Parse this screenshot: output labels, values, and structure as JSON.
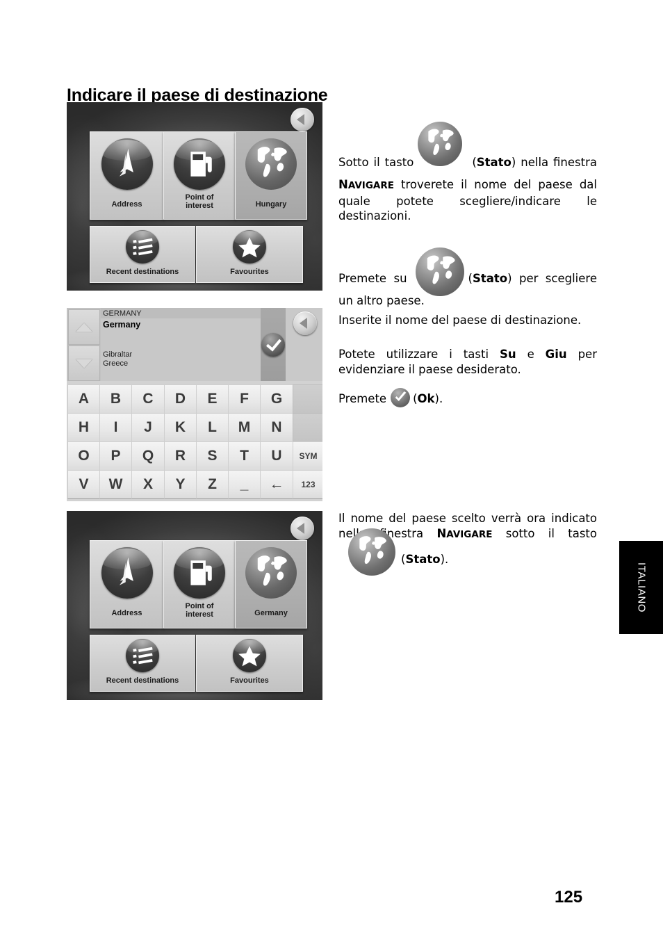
{
  "page": {
    "title": "Indicare il paese di destinazione",
    "number": "125",
    "language_tab": "ITALIANO"
  },
  "screenshots": [
    {
      "name": "navigate-window-hungary",
      "back_button_icon": "back-arrow-icon",
      "tiles": [
        {
          "label": "Address",
          "icon": "address-flag-icon",
          "state": "normal"
        },
        {
          "label": "Point of\ninterest",
          "line1": "Point of",
          "line2": "interest",
          "icon": "fuel-pump-icon",
          "state": "normal"
        },
        {
          "label": "Hungary",
          "icon": "globe-icon",
          "state": "dimmed"
        },
        {
          "label": "Recent destinations",
          "icon": "list-icon",
          "state": "normal"
        },
        {
          "label": "Favourites",
          "icon": "star-icon",
          "state": "normal"
        }
      ]
    },
    {
      "name": "country-keyboard-window",
      "list_header": "GERMANY",
      "selected_item": "Germany",
      "list_items": [
        "Gibraltar",
        "Greece"
      ],
      "up_button_icon": "triangle-up-icon",
      "down_button_icon": "triangle-down-icon",
      "ok_button_icon": "check-icon",
      "back_button_icon": "back-arrow-icon",
      "keyboard_rows": [
        [
          "A",
          "B",
          "C",
          "D",
          "E",
          "F",
          "G",
          ""
        ],
        [
          "H",
          "I",
          "J",
          "K",
          "L",
          "M",
          "N",
          ""
        ],
        [
          "O",
          "P",
          "Q",
          "R",
          "S",
          "T",
          "U",
          "SYM"
        ],
        [
          "V",
          "W",
          "X",
          "Y",
          "Z",
          "_",
          "←",
          "123"
        ]
      ]
    },
    {
      "name": "navigate-window-germany",
      "back_button_icon": "back-arrow-icon",
      "tiles": [
        {
          "label": "Address",
          "icon": "address-flag-icon",
          "state": "normal"
        },
        {
          "label": "Point of\ninterest",
          "line1": "Point of",
          "line2": "interest",
          "icon": "fuel-pump-icon",
          "state": "normal"
        },
        {
          "label": "Germany",
          "icon": "globe-icon",
          "state": "dimmed"
        },
        {
          "label": "Recent destinations",
          "icon": "list-icon",
          "state": "normal"
        },
        {
          "label": "Favourites",
          "icon": "star-icon",
          "state": "normal"
        }
      ]
    }
  ],
  "body": {
    "p1": {
      "before_icon": "Sotto il tasto",
      "icon": "globe-icon",
      "after_icon_1": "(",
      "bold_stato": "Stato",
      "after_icon_2": ") nella finestra ",
      "smallcaps_navigare_big": "N",
      "smallcaps_navigare_rest": "AVIGARE",
      "tail": " troverete il nome del paese dal quale potete scegliere/indicare le destinazioni."
    },
    "p2": {
      "before_icon": "Premete su",
      "icon": "globe-icon",
      "open_paren": "(",
      "bold_stato": "Stato",
      "tail": ") per scegliere un altro paese."
    },
    "p3": {
      "text": "Inserite il nome del paese di destinazione."
    },
    "p4": {
      "part1": "Potete utilizzare i tasti ",
      "bold_su": "Su",
      "part2": " e ",
      "bold_giu": "Giu",
      "part3": " per evidenziare il paese desiderato."
    },
    "p5": {
      "before_icon": "Premete",
      "icon": "check-icon",
      "open_paren": "(",
      "bold_ok": "Ok",
      "tail": ")."
    },
    "p6": {
      "part1": "Il nome del paese scelto verrà ora indicato nella finestra ",
      "smallcaps_navigare_big": "N",
      "smallcaps_navigare_rest": "AVIGARE",
      "part2": " sotto il tasto",
      "icon": "globe-icon",
      "open_paren": "(",
      "bold_stato": "Stato",
      "tail": ")."
    }
  },
  "colors": {
    "page_bg": "#ffffff",
    "text": "#000000",
    "tab_bg": "#000000",
    "tab_text": "#ffffff",
    "shot_bg": "#3a3a3a",
    "tile_bg": "#cdcdcd",
    "tile_dim_bg": "#aeaeae",
    "key_bg": "#e8e8e8"
  }
}
